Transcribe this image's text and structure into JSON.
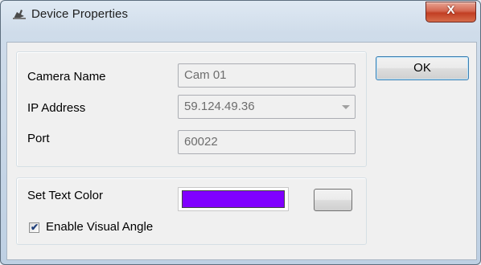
{
  "window": {
    "title": "Device Properties",
    "close_label": "X"
  },
  "fields": {
    "camera_name": {
      "label": "Camera Name",
      "value": "Cam 01"
    },
    "ip_address": {
      "label": "IP Address",
      "value": "59.124.49.36"
    },
    "port": {
      "label": "Port",
      "value": "60022"
    }
  },
  "text_color": {
    "label": "Set Text Color",
    "color": "#8000ff"
  },
  "visual_angle": {
    "label": "Enable Visual Angle",
    "checked": true
  },
  "buttons": {
    "ok_label": "OK",
    "color_picker_label": ""
  }
}
